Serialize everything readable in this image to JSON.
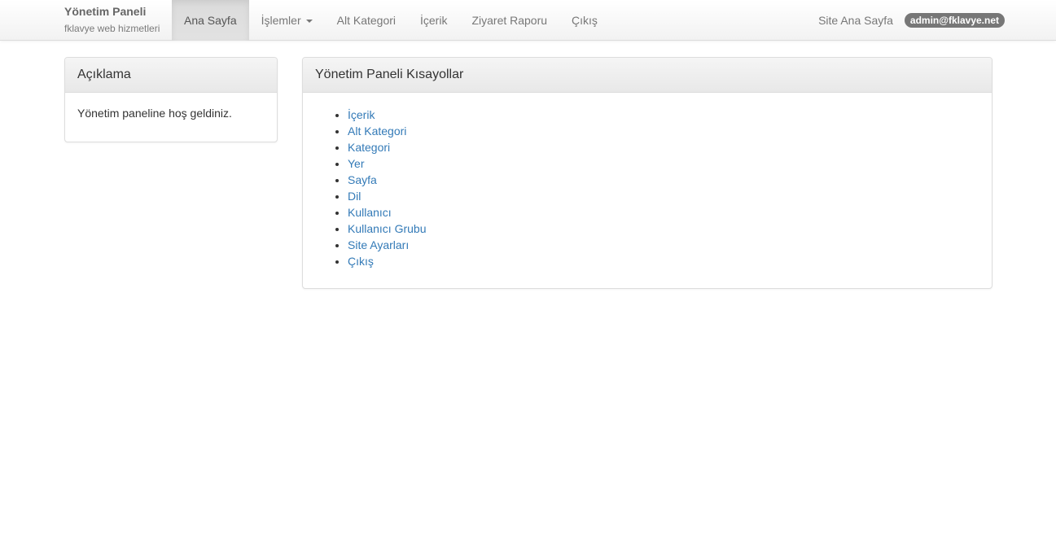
{
  "navbar": {
    "brand_title": "Yönetim Paneli",
    "brand_subtitle": "fklavye web hizmetleri",
    "items": [
      {
        "label": "Ana Sayfa",
        "active": true
      },
      {
        "label": "İşlemler",
        "dropdown": true
      },
      {
        "label": "Alt Kategori"
      },
      {
        "label": "İçerik"
      },
      {
        "label": "Ziyaret Raporu"
      },
      {
        "label": "Çıkış"
      }
    ],
    "site_link": "Site Ana Sayfa",
    "user_badge": "admin@fklavye.net"
  },
  "description_panel": {
    "title": "Açıklama",
    "body": "Yönetim paneline hoş geldiniz."
  },
  "shortcuts_panel": {
    "title": "Yönetim Paneli Kısayollar",
    "links": [
      "İçerik",
      "Alt Kategori",
      "Kategori",
      "Yer",
      "Sayfa",
      "Dil",
      "Kullanıcı",
      "Kullanıcı Grubu",
      "Site Ayarları",
      "Çıkış"
    ]
  },
  "colors": {
    "link": "#337ab7",
    "badge": "#777777",
    "nav_text": "#777777"
  }
}
